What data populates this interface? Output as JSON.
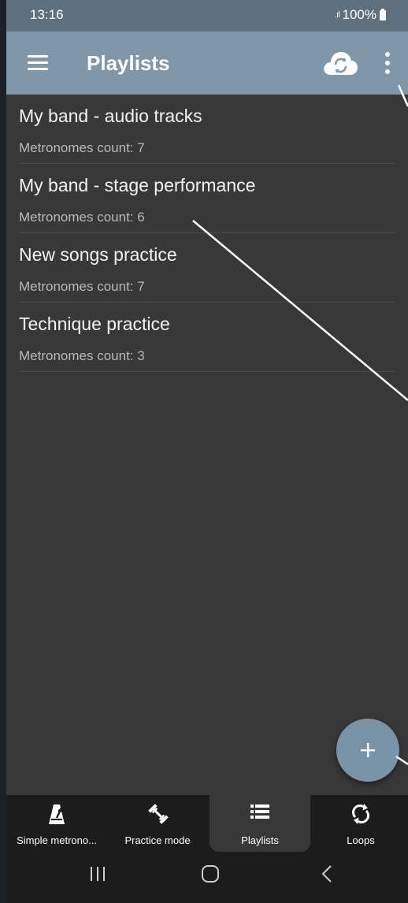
{
  "status_bar": {
    "time": "13:16",
    "battery": "100%"
  },
  "app_bar": {
    "title": "Playlists"
  },
  "playlists": [
    {
      "title": "My band - audio tracks",
      "subtitle": "Metronomes count: 7"
    },
    {
      "title": "My band - stage performance",
      "subtitle": "Metronomes count: 6"
    },
    {
      "title": "New songs practice",
      "subtitle": "Metronomes count: 7"
    },
    {
      "title": "Technique practice",
      "subtitle": "Metronomes count: 3"
    }
  ],
  "bottom_nav": {
    "tabs": [
      {
        "label": "Simple metrono...",
        "icon": "metronome-icon"
      },
      {
        "label": "Practice mode",
        "icon": "dumbbell-icon"
      },
      {
        "label": "Playlists",
        "icon": "list-icon",
        "active": true
      },
      {
        "label": "Loops",
        "icon": "loop-icon"
      }
    ]
  },
  "colors": {
    "app_bar": "#7f97a9",
    "status_bar": "#5f6f7c",
    "background": "#383838",
    "fab": "#7a93a6",
    "nav_bar": "#1c1c1c"
  }
}
